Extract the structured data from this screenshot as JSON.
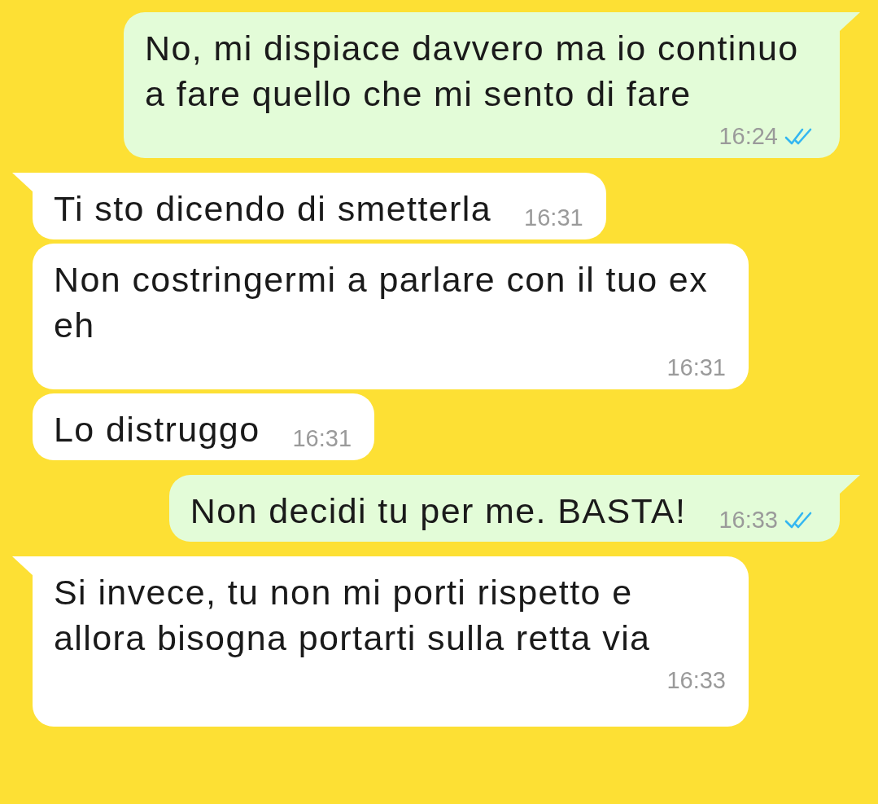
{
  "messages": [
    {
      "outgoing": true,
      "text": "No, mi dispiace davvero ma io continuo a fare quello che mi sento di fare",
      "time": "16:24",
      "read": true
    },
    {
      "outgoing": false,
      "text": "Ti sto dicendo di smetterla",
      "time": "16:31"
    },
    {
      "outgoing": false,
      "text": "Non costringermi a parlare con il tuo ex eh",
      "time": "16:31"
    },
    {
      "outgoing": false,
      "text": "Lo distruggo",
      "time": "16:31"
    },
    {
      "outgoing": true,
      "text": "Non decidi tu per me. BASTA!",
      "time": "16:33",
      "read": true
    },
    {
      "outgoing": false,
      "text": "Si invece, tu non mi porti rispetto e allora bisogna portarti sulla retta via",
      "time": "16:33"
    }
  ]
}
